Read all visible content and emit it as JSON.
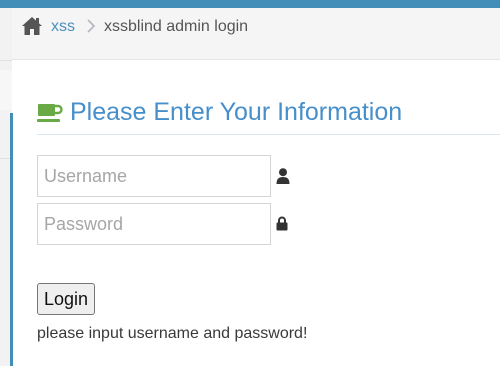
{
  "breadcrumb": {
    "home_icon": "home-icon",
    "link_label": "xss",
    "separator_icon": "chevron-right-icon",
    "current_label": "xssblind admin login"
  },
  "header": {
    "icon": "coffee-cup-icon",
    "title": "Please Enter Your Information"
  },
  "form": {
    "username": {
      "value": "",
      "placeholder": "Username",
      "icon": "user-icon"
    },
    "password": {
      "value": "",
      "placeholder": "Password",
      "icon": "lock-icon"
    },
    "login_label": "Login",
    "status_message": "please input username and password!"
  },
  "colors": {
    "accent": "#438eb9",
    "link": "#4c8fbd",
    "header_title": "#478fca",
    "cup_icon": "#69aa46"
  }
}
